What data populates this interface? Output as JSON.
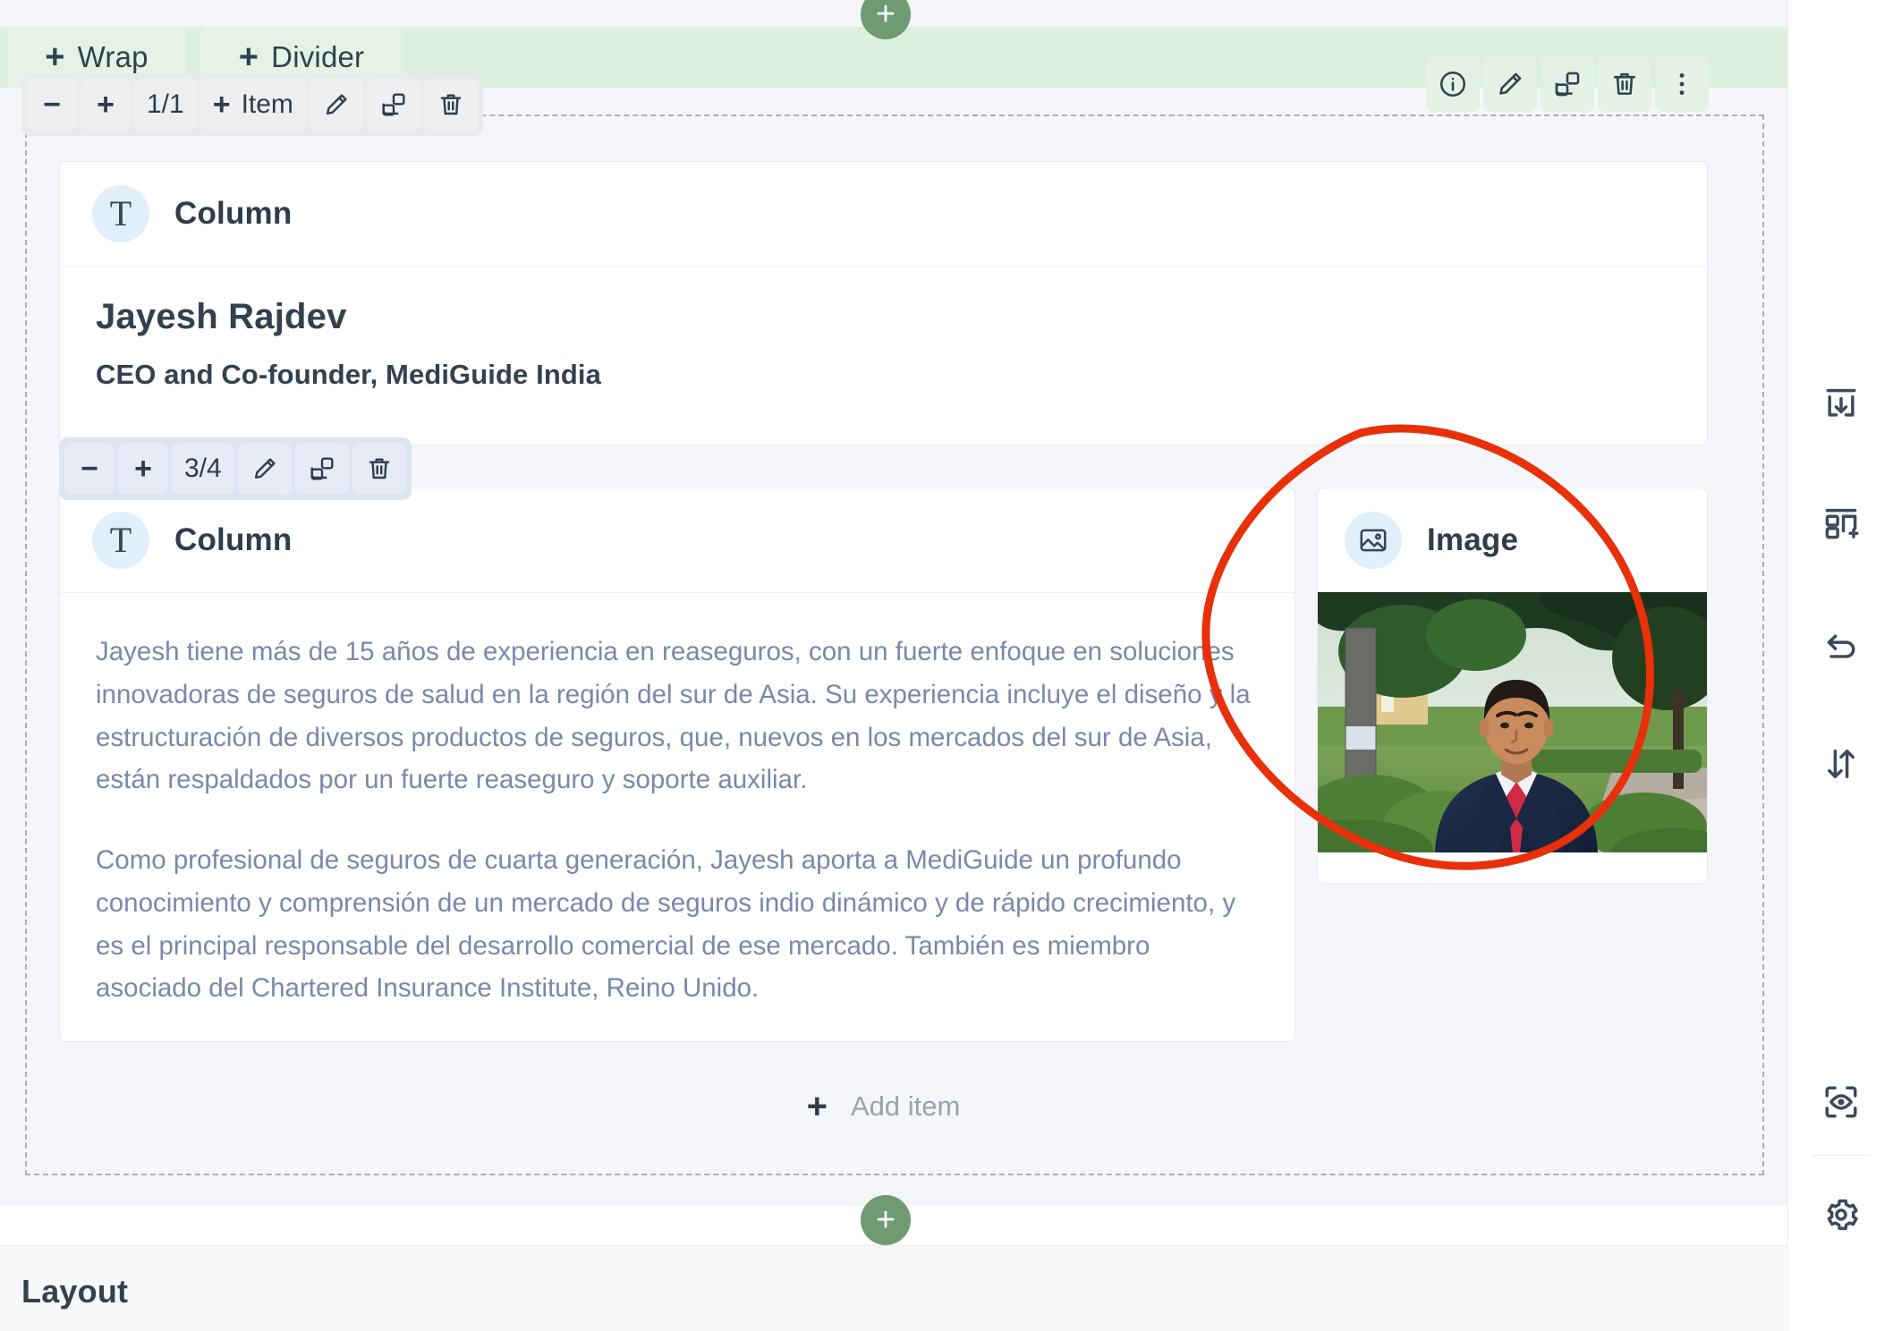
{
  "section_toolbar": {
    "chips": [
      {
        "id": "wrap",
        "label": "Wrap",
        "plus": "+",
        "icon": "plus-icon"
      },
      {
        "id": "divider",
        "label": "Divider",
        "plus": "+",
        "icon": "plus-icon"
      }
    ],
    "actions": [
      {
        "id": "info",
        "icon": "info-circle-icon"
      },
      {
        "id": "edit",
        "icon": "pencil-icon"
      },
      {
        "id": "duplicate",
        "icon": "copy-icon"
      },
      {
        "id": "delete",
        "icon": "trash-icon"
      },
      {
        "id": "more",
        "icon": "more-vertical-icon"
      }
    ],
    "accent_color": "#ddf0de"
  },
  "add_section_buttons": {
    "top_label": "+",
    "bottom_label": "+",
    "color": "#6e9b72"
  },
  "row_toolbar_1": {
    "decrease": "−",
    "increase": "+",
    "ratio": "1/1",
    "add_item_plus": "+",
    "add_item_label": "Item",
    "edit_icon": "pencil-icon",
    "duplicate_icon": "copy-icon",
    "delete_icon": "trash-icon"
  },
  "row_toolbar_2": {
    "decrease": "−",
    "increase": "+",
    "ratio": "3/4",
    "edit_icon": "pencil-icon",
    "duplicate_icon": "copy-icon",
    "delete_icon": "trash-icon"
  },
  "blocks": {
    "name_block": {
      "head_icon": "text-block-icon",
      "head_glyph": "T",
      "head_label": "Column",
      "name": "Jayesh Rajdev",
      "role": "CEO and Co-founder, MediGuide India"
    },
    "text_block": {
      "head_icon": "text-block-icon",
      "head_glyph": "T",
      "head_label": "Column",
      "paragraphs": [
        "Jayesh tiene más de 15 años de experiencia en reaseguros, con un fuerte enfoque en soluciones innovadoras de seguros de salud en la región del sur de Asia. Su experiencia incluye el diseño y la estructuración de diversos productos de seguros, que, nuevos en los mercados del sur de Asia, están respaldados por un fuerte reaseguro y soporte auxiliar.",
        "Como profesional de seguros de cuarta generación, Jayesh aporta a MediGuide un profundo conocimiento y comprensión de un mercado de seguros indio dinámico y de rápido crecimiento, y es el principal responsable del desarrollo comercial de ese mercado. También es miembro asociado del Chartered Insurance Institute, Reino Unido."
      ],
      "text_color": "#7b87ab"
    },
    "image_block": {
      "head_icon": "image-icon",
      "head_label": "Image",
      "photo_alt": "Portrait photo of a man in a navy suit with a red tie standing on a garden path"
    }
  },
  "add_item_row": {
    "plus": "+",
    "label": "Add item"
  },
  "right_rail": {
    "top_items": [
      {
        "id": "insert-below",
        "icon": "insert-box-down-icon"
      },
      {
        "id": "add-layout",
        "icon": "layout-add-icon"
      },
      {
        "id": "undo",
        "icon": "undo-arrow-icon"
      },
      {
        "id": "reorder",
        "icon": "sort-updown-icon"
      }
    ],
    "bottom_items": [
      {
        "id": "preview",
        "icon": "eye-scan-icon"
      },
      {
        "id": "settings",
        "icon": "gear-icon"
      }
    ]
  },
  "bottom_panel": {
    "title": "Layout"
  },
  "annotation": {
    "shape": "hand-drawn-circle",
    "color": "#e8300b",
    "target": "image-block"
  }
}
